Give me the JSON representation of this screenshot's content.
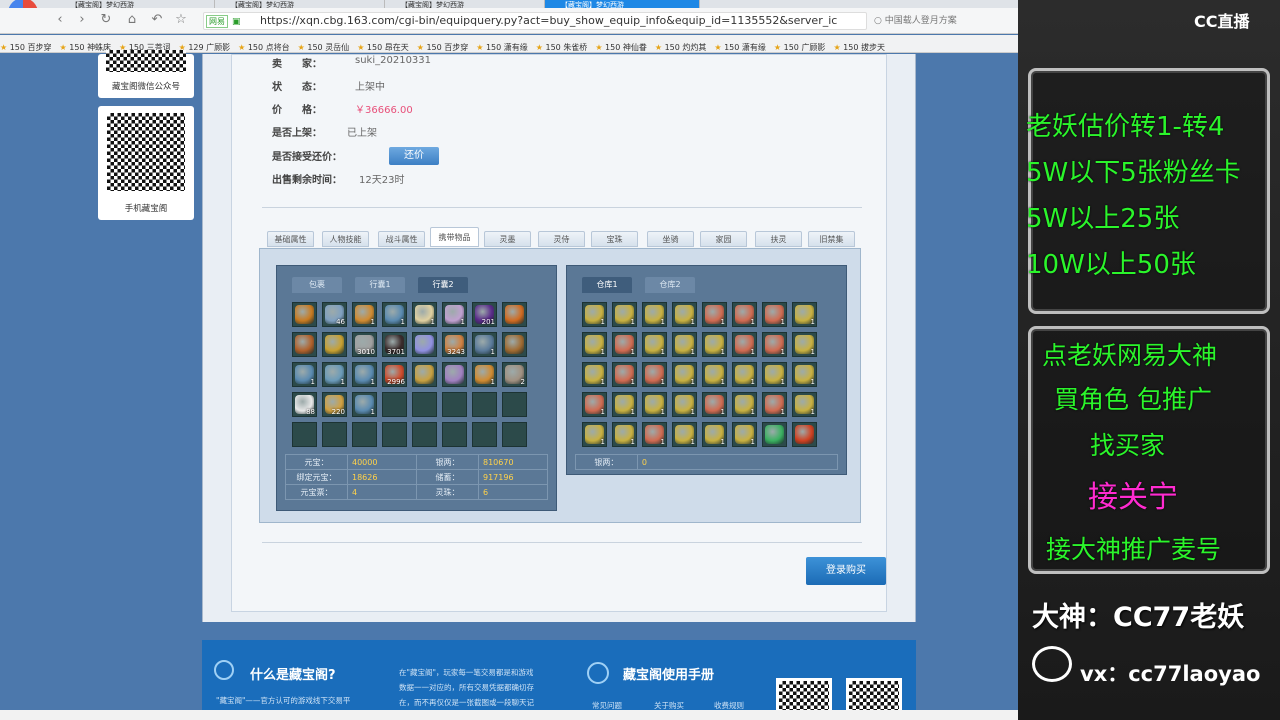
{
  "browser": {
    "tabs": [
      "【藏宝阁】梦幻西游",
      "【藏宝阁】梦幻西游",
      "【藏宝阁】梦幻西游",
      "【藏宝阁】梦幻西游"
    ],
    "url_tag": "网易",
    "url": "https://xqn.cbg.163.com/cgi-bin/equipquery.py?act=buy_show_equip_info&equip_id=1135552&server_ic",
    "search": "中国载人登月方案",
    "bookmarks": [
      "150 百步穿",
      "150 神蛛床",
      "150 三菩词",
      "129 广顾影",
      "150 点将台",
      "150 灵岳仙",
      "150 昂在天",
      "150 百步穿",
      "150 潇有缘",
      "150 朱雀桥",
      "150 神仙眷",
      "150 灼灼其",
      "150 潇有缘",
      "150 广顾影",
      "150 拔步天"
    ]
  },
  "qr_cards": [
    {
      "label": "藏宝阁微信公众号"
    },
    {
      "label": "手机藏宝阁"
    }
  ],
  "info": {
    "seller_label": "卖　　家：",
    "seller": "suki_20210331",
    "status_label": "状　　态：",
    "status": "上架中",
    "price_label": "价　　格：",
    "price": "￥36666.00",
    "listed_label": "是否上架：",
    "listed": "已上架",
    "bargain_label": "是否接受还价：",
    "bargain_btn": "还价",
    "remain_label": "出售剩余时间：",
    "remain": "12天23时"
  },
  "tabs": [
    "基础属性",
    "人物技能",
    "战斗属性",
    "携带物品",
    "灵墨",
    "灵侍",
    "宝珠",
    "坐骑",
    "家园",
    "扶灵",
    "旧禁集"
  ],
  "active_tab": "携带物品",
  "bag": {
    "subtabs": [
      "包裹",
      "行囊1",
      "行囊2"
    ],
    "active": "行囊2",
    "items": [
      {
        "c": "#c87a20",
        "n": ""
      },
      {
        "c": "#7fa0c0",
        "n": "46"
      },
      {
        "c": "#d08a30",
        "n": "1"
      },
      {
        "c": "#5a8ab0",
        "n": "1"
      },
      {
        "c": "#e0d0a0",
        "n": "1"
      },
      {
        "c": "#c0a0d0",
        "n": "1"
      },
      {
        "c": "#5a2a8a",
        "n": "201"
      },
      {
        "c": "#d06a20",
        "n": ""
      },
      {
        "c": "#b0602a",
        "n": ""
      },
      {
        "c": "#c8a030",
        "n": ""
      },
      {
        "c": "#a0a0a0",
        "n": "3010"
      },
      {
        "c": "#3a2a2a",
        "n": "3701"
      },
      {
        "c": "#9090e0",
        "n": ""
      },
      {
        "c": "#d08040",
        "n": "3243"
      },
      {
        "c": "#5a7a9a",
        "n": "1"
      },
      {
        "c": "#a06a30",
        "n": ""
      },
      {
        "c": "#5a8ab0",
        "n": "1"
      },
      {
        "c": "#6a9ab8",
        "n": "1"
      },
      {
        "c": "#5a8ab0",
        "n": "1"
      },
      {
        "c": "#d04a2a",
        "n": "2996"
      },
      {
        "c": "#c8a040",
        "n": ""
      },
      {
        "c": "#a080c0",
        "n": ""
      },
      {
        "c": "#d08a30",
        "n": "1"
      },
      {
        "c": "#a09080",
        "n": "2"
      },
      {
        "c": "#e8e8e8",
        "n": "88"
      },
      {
        "c": "#d0a040",
        "n": "220"
      },
      {
        "c": "#5a8ab0",
        "n": "1"
      },
      {
        "c": "",
        "n": ""
      },
      {
        "c": "",
        "n": ""
      },
      {
        "c": "",
        "n": ""
      },
      {
        "c": "",
        "n": ""
      },
      {
        "c": "",
        "n": ""
      },
      {
        "c": "",
        "n": ""
      },
      {
        "c": "",
        "n": ""
      },
      {
        "c": "",
        "n": ""
      },
      {
        "c": "",
        "n": ""
      },
      {
        "c": "",
        "n": ""
      },
      {
        "c": "",
        "n": ""
      },
      {
        "c": "",
        "n": ""
      },
      {
        "c": "",
        "n": ""
      }
    ],
    "stats": [
      [
        "元宝：",
        "40000",
        "银两：",
        "810670"
      ],
      [
        "绑定元宝：",
        "18626",
        "储蓄：",
        "917196"
      ],
      [
        "元宝票：",
        "4",
        "灵珠：",
        "6"
      ]
    ]
  },
  "warehouse": {
    "subtabs": [
      "仓库1",
      "仓库2"
    ],
    "active": "仓库1",
    "items": [
      {
        "c": "#c8b040",
        "n": "1"
      },
      {
        "c": "#c8b040",
        "n": "1"
      },
      {
        "c": "#c8b040",
        "n": "1"
      },
      {
        "c": "#c8b040",
        "n": "1"
      },
      {
        "c": "#d06a50",
        "n": "1"
      },
      {
        "c": "#d06a50",
        "n": "1"
      },
      {
        "c": "#d06a50",
        "n": "1"
      },
      {
        "c": "#c8b040",
        "n": "1"
      },
      {
        "c": "#c8b040",
        "n": "1"
      },
      {
        "c": "#d06a50",
        "n": "1"
      },
      {
        "c": "#c8b040",
        "n": "1"
      },
      {
        "c": "#c8b040",
        "n": "1"
      },
      {
        "c": "#c8b040",
        "n": "1"
      },
      {
        "c": "#d06a50",
        "n": "1"
      },
      {
        "c": "#d06a50",
        "n": "1"
      },
      {
        "c": "#c8b040",
        "n": "1"
      },
      {
        "c": "#c8b040",
        "n": "1"
      },
      {
        "c": "#d06a50",
        "n": "1"
      },
      {
        "c": "#d06a50",
        "n": "1"
      },
      {
        "c": "#c8b040",
        "n": "1"
      },
      {
        "c": "#c8b040",
        "n": "1"
      },
      {
        "c": "#c8b040",
        "n": "1"
      },
      {
        "c": "#c8b040",
        "n": "1"
      },
      {
        "c": "#c8b040",
        "n": "1"
      },
      {
        "c": "#d06a50",
        "n": "1"
      },
      {
        "c": "#c8b040",
        "n": "1"
      },
      {
        "c": "#c8b040",
        "n": "1"
      },
      {
        "c": "#c8b040",
        "n": "1"
      },
      {
        "c": "#d06a50",
        "n": "1"
      },
      {
        "c": "#c8b040",
        "n": "1"
      },
      {
        "c": "#d06a50",
        "n": "1"
      },
      {
        "c": "#c8b040",
        "n": "1"
      },
      {
        "c": "#c8b040",
        "n": "1"
      },
      {
        "c": "#c8b040",
        "n": "1"
      },
      {
        "c": "#d06a50",
        "n": "1"
      },
      {
        "c": "#c8b040",
        "n": "1"
      },
      {
        "c": "#c8b040",
        "n": "1"
      },
      {
        "c": "#c8b040",
        "n": "1"
      },
      {
        "c": "#3ab060",
        "n": ""
      },
      {
        "c": "#d04020",
        "n": ""
      }
    ],
    "silver_label": "银两：",
    "silver": "0"
  },
  "buy_button": "登录购买",
  "footer": {
    "what_title": "什么是藏宝阁?",
    "what_text": "\"藏宝阁\"——官方认可的游戏线下交易平",
    "mid_text1": "在\"藏宝阁\"，玩家每一笔交易都是和游戏",
    "mid_text2": "数据一一对应的，所有交易凭据都确切存",
    "mid_text3": "在，而不再仅仅是一张截图或一段聊天记",
    "manual_title": "藏宝阁使用手册",
    "links": [
      "常见问题",
      "关于购买",
      "收费规则"
    ]
  },
  "stream": {
    "logo": "CC直播",
    "box1": [
      "老妖估价转1-转4",
      "5W以下5张粉丝卡",
      "5W以上25张",
      "10W以上50张"
    ],
    "box2": [
      "点老妖网易大神",
      "買角色 包推广",
      "找买家",
      "接关宁",
      "接大神推广麦号"
    ],
    "dashen": "大神：CC77老妖",
    "vx": "vx：cc77laoyao"
  }
}
